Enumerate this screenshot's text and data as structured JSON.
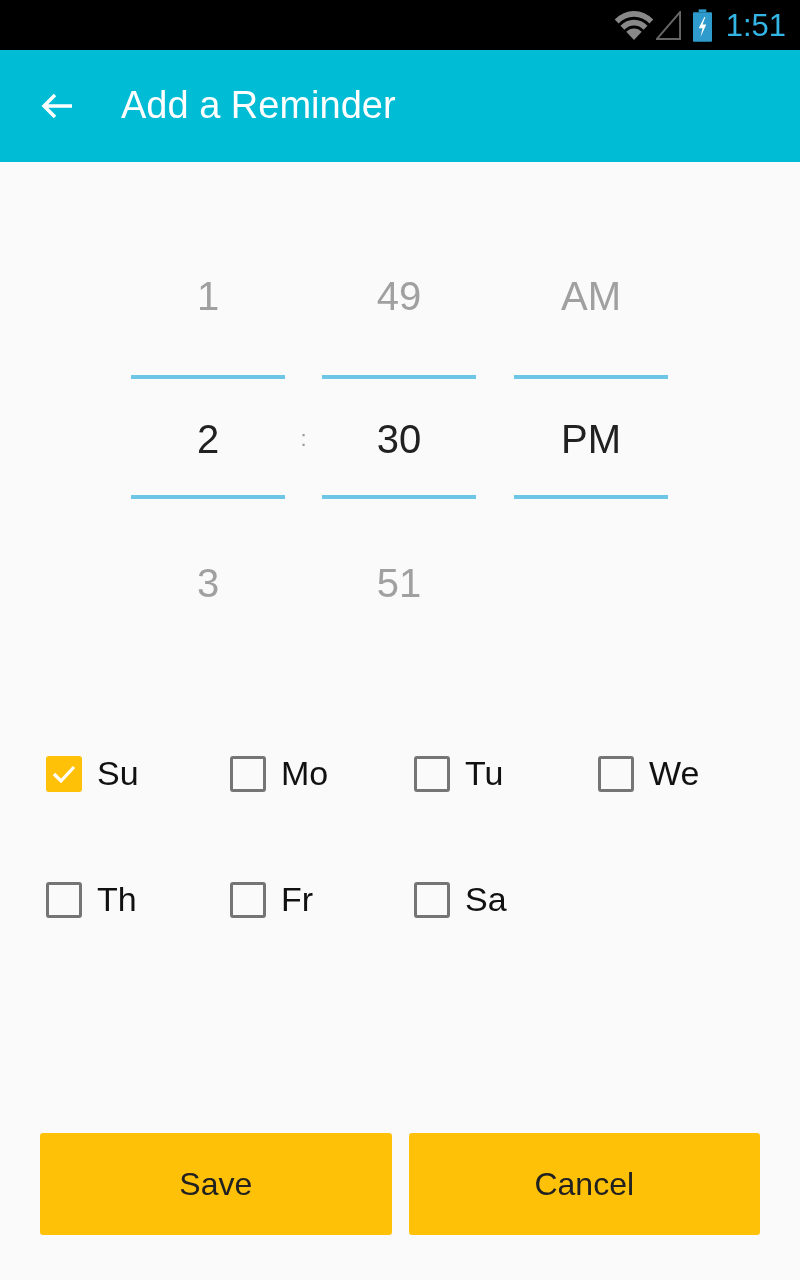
{
  "status_bar": {
    "time": "1:51"
  },
  "app_bar": {
    "title": "Add a Reminder"
  },
  "time_picker": {
    "columns": [
      {
        "kind": "wheel",
        "above": "1",
        "value": "2",
        "below": "3"
      },
      {
        "kind": "separator",
        "text": ":"
      },
      {
        "kind": "wheel",
        "above": "49",
        "value": "30",
        "below": "51"
      },
      {
        "kind": "wheel",
        "above": "AM",
        "value": "PM"
      }
    ]
  },
  "days": [
    {
      "label": "Su",
      "checked": true
    },
    {
      "label": "Mo",
      "checked": false
    },
    {
      "label": "Tu",
      "checked": false
    },
    {
      "label": "We",
      "checked": false
    },
    {
      "label": "Th",
      "checked": false
    },
    {
      "label": "Fr",
      "checked": false
    },
    {
      "label": "Sa",
      "checked": false
    }
  ],
  "buttons": [
    {
      "label": "Save"
    },
    {
      "label": "Cancel"
    }
  ]
}
